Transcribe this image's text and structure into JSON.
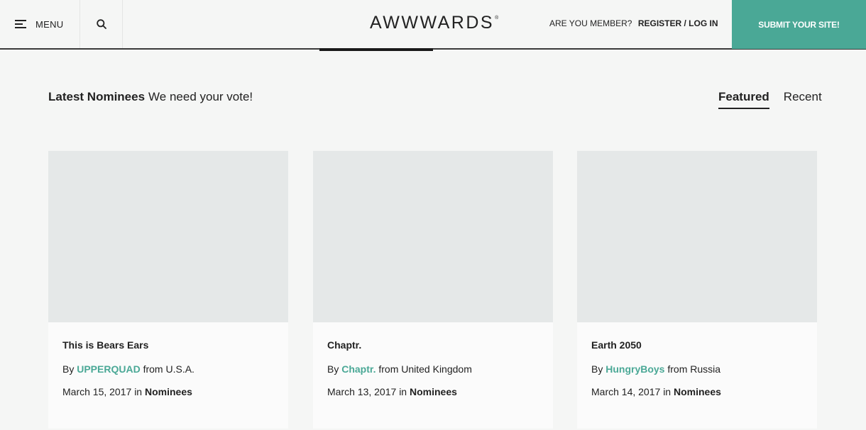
{
  "header": {
    "menu_label": "MENU",
    "logo_text": "AWWWARDS",
    "logo_mark": "®",
    "member_question": "ARE YOU MEMBER?",
    "register_label": "REGISTER / LOG IN",
    "submit_label": "SUBMIT YOUR SITE!"
  },
  "section": {
    "title": "Latest Nominees",
    "subtitle": "We need your vote!",
    "tabs": [
      {
        "label": "Featured",
        "active": true
      },
      {
        "label": "Recent",
        "active": false
      }
    ]
  },
  "cards": [
    {
      "title": "This is Bears Ears",
      "by_prefix": "By",
      "author": "UPPERQUAD",
      "from_text": "from U.S.A.",
      "date": "March 15, 2017",
      "in_text": "in",
      "category": "Nominees"
    },
    {
      "title": "Chaptr.",
      "by_prefix": "By",
      "author": "Chaptr.",
      "from_text": "from United Kingdom",
      "date": "March 13, 2017",
      "in_text": "in",
      "category": "Nominees"
    },
    {
      "title": "Earth 2050",
      "by_prefix": "By",
      "author": "HungryBoys",
      "from_text": "from Russia",
      "date": "March 14, 2017",
      "in_text": "in",
      "category": "Nominees"
    }
  ],
  "colors": {
    "accent": "#4aa896",
    "background": "#f5f6f5",
    "card_placeholder": "#e5e8e8"
  }
}
